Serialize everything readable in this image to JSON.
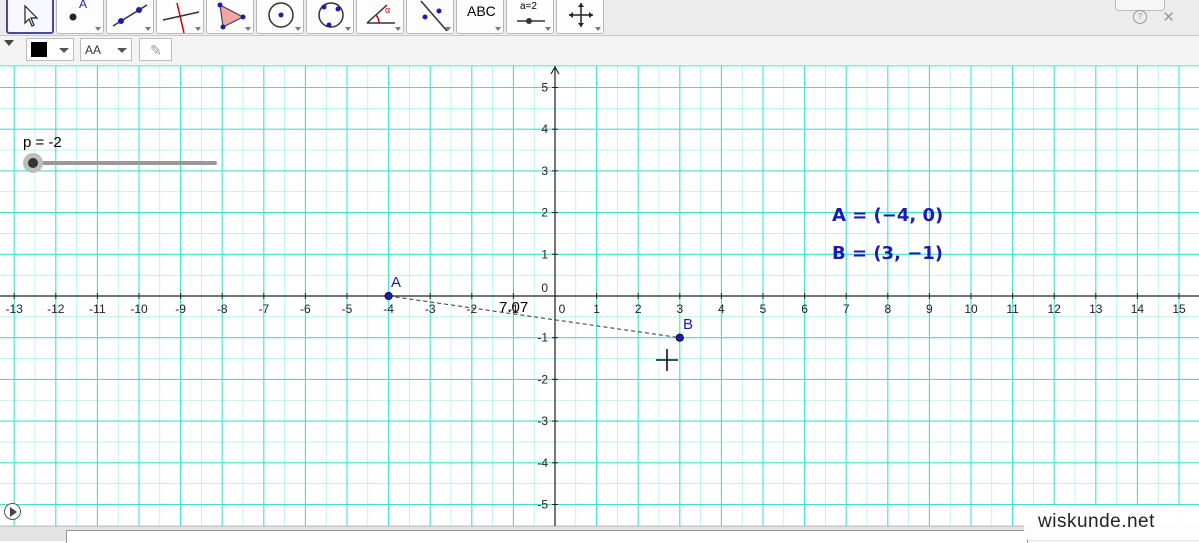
{
  "toolbar": {
    "tools": [
      {
        "name": "move-tool",
        "active": true
      },
      {
        "name": "point-tool",
        "label": "A"
      },
      {
        "name": "line-tool"
      },
      {
        "name": "perpendicular-line-tool"
      },
      {
        "name": "polygon-tool"
      },
      {
        "name": "circle-center-point-tool"
      },
      {
        "name": "circle-three-points-tool"
      },
      {
        "name": "angle-tool",
        "label": "α"
      },
      {
        "name": "reflect-tool"
      },
      {
        "name": "text-tool",
        "label": "ABC"
      },
      {
        "name": "slider-tool",
        "label": "a=2"
      },
      {
        "name": "move-graphics-view-tool"
      }
    ]
  },
  "stylebar": {
    "color": "#000000",
    "text_size_label": "AA"
  },
  "slider": {
    "label": "p = -2",
    "value": -2
  },
  "algebra": {
    "point_a": "A = (−4, 0)",
    "point_b": "B = (3, −1)"
  },
  "graph": {
    "x_ticks": [
      "-13",
      "-12",
      "-11",
      "-10",
      "-9",
      "-8",
      "-7",
      "-6",
      "-5",
      "-4",
      "-3",
      "-2",
      "-1",
      "0",
      "1",
      "2",
      "3",
      "4",
      "5",
      "6",
      "7",
      "8",
      "9",
      "10",
      "11",
      "12",
      "13",
      "14",
      "15"
    ],
    "y_ticks": [
      "5",
      "4",
      "3",
      "2",
      "1",
      "0",
      "-1",
      "-2",
      "-3",
      "-4",
      "-5"
    ],
    "x_range": [
      -13,
      15
    ],
    "y_range": [
      -5,
      5
    ],
    "grid_color": "#40e0d0",
    "points": [
      {
        "label": "A",
        "x": -4,
        "y": 0
      },
      {
        "label": "B",
        "x": 3,
        "y": -1
      }
    ],
    "distance_label": "7.07",
    "point_color": "#1b1bb0"
  },
  "watermark": "wiskunde.net"
}
